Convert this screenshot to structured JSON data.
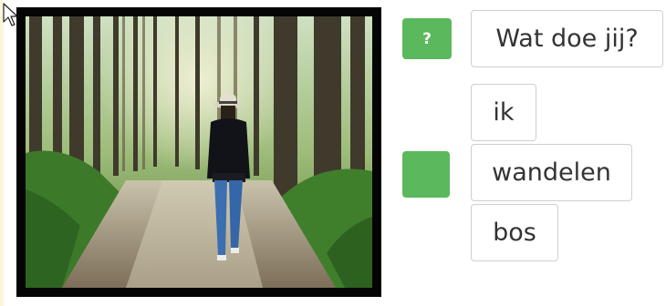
{
  "question": {
    "badge_symbol": "?",
    "text": "Wat doe jij?"
  },
  "answer": {
    "badge_symbol": "",
    "words": [
      "ik",
      "wandelen",
      "bos"
    ]
  },
  "image": {
    "subject": "person walking on forest path"
  },
  "colors": {
    "badge": "#5cb85c",
    "frame": "#050505",
    "word_border": "#cfcfcf",
    "word_text": "#333333"
  },
  "icons": {
    "cursor": "mouse-pointer-icon"
  }
}
